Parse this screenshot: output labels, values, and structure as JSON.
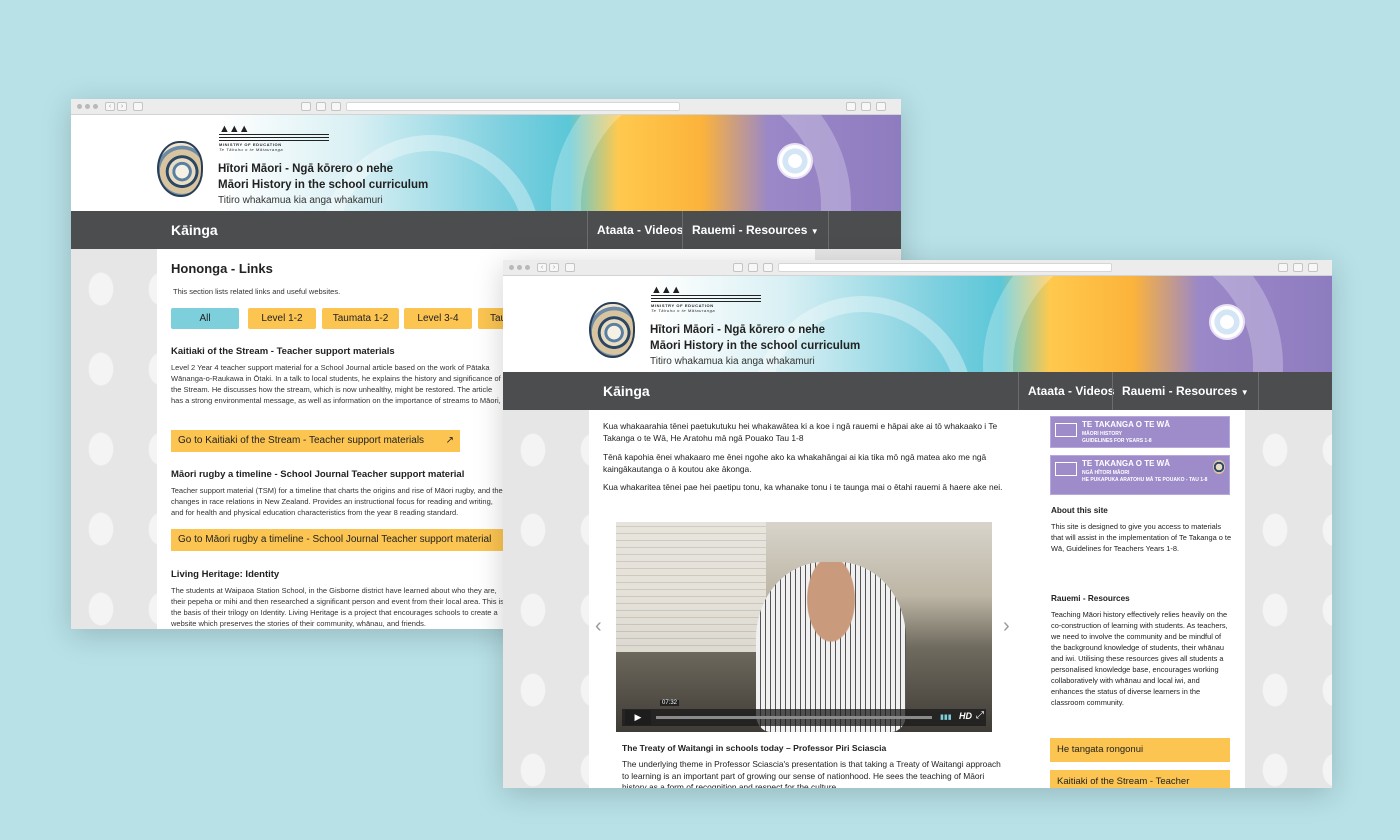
{
  "colors": {
    "background": "#b7e1e7",
    "nav": "#4b4d4f",
    "accent_yellow": "#fcc552",
    "accent_teal": "#7dcfdc",
    "accent_purple": "#9d8cc9"
  },
  "site": {
    "ministry": "MINISTRY OF EDUCATION",
    "ministry_sub": "Te Tāhuhu o te Mātauranga",
    "title_maori": "Hītori Māori - Ngā kōrero o nehe",
    "title_english": "Māori History in the school curriculum",
    "tagline": "Titiro whakamua kia anga whakamuri",
    "nav": {
      "home": "Kāinga",
      "videos": "Ataata - Videos",
      "resources": "Rauemi - Resources"
    }
  },
  "back_page": {
    "heading": "Hononga - Links",
    "intro": "This section lists related links and useful websites.",
    "filters": [
      "All",
      "Level 1-2",
      "Taumata 1-2",
      "Level 3-4",
      "Tau"
    ],
    "links": [
      {
        "title": "Kaitiaki of the Stream - Teacher support materials",
        "body": "Level 2 Year 4 teacher support material for a School Journal article based on the work of Pātaka Wānanga-o-Raukawa in Ōtaki. In a talk to local students, he explains the history and significance of the Stream. He discusses how the stream, which is now unhealthy, might be restored. The article has a strong environmental message, as well as information on the importance of streams to Māori, with particular reference to tuna (eels).",
        "button": "Go to Kaitiaki of the Stream - Teacher support materials"
      },
      {
        "title": "Māori rugby a timeline - School Journal Teacher support material",
        "body": "Teacher support material (TSM) for a timeline that charts the origins and rise of Māori rugby, and the changes in race relations in New Zealand. Provides an instructional focus for reading and writing, and for health and physical education characteristics from the year 8 reading standard.",
        "button": "Go to Māori rugby a timeline - School Journal Teacher support material"
      },
      {
        "title": "Living Heritage: Identity",
        "body": "The students at Waipaoa Station School, in the Gisborne district have learned about who they are, their pepeha or mihi and then researched a significant person and event from their local area. This is the basis of their trilogy on Identity. Living Heritage is a project that encourages schools to create a website which preserves the stories of their community, whānau, and friends.",
        "button": ""
      }
    ]
  },
  "front_page": {
    "intro": [
      "Kua whakaarahia tēnei paetukutuku hei whakawātea ki a koe i ngā rauemi e hāpai ake ai tō whakaako i Te Takanga o te Wā, He Aratohu mā ngā Pouako Tau 1-8",
      "Tēnā kapohia ēnei whakaaro me ēnei ngohe ako ka whakahāngai ai kia tika mō ngā matea ako me ngā kaingākautanga o ā koutou ake ākonga.",
      "Kua whakaritea tēnei pae hei paetipu tonu, ka whanake tonu i te taunga mai o ētahi rauemi ā haere ake nei."
    ],
    "video": {
      "time": "07:32",
      "hd": "HD",
      "caption": "The Treaty of Waitangi in schools today – Professor Piri Sciascia"
    },
    "video_text": "The underlying theme in Professor Sciascia's presentation is that taking a Treaty of Waitangi approach to learning is an important part of growing our sense of nationhood. He sees the teaching of Māori history as a form of recognition and respect for the culture.",
    "sidebar": {
      "cards": [
        {
          "title": "TE TAKANGA O TE WĀ",
          "sub1": "MĀORI HISTORY",
          "sub2": "GUIDELINES FOR YEARS 1-8"
        },
        {
          "title": "TE TAKANGA O TE WĀ",
          "sub1": "NGĀ HĪTORI MĀORI",
          "sub2": "HE PUKAPUKA ARATOHU MĀ TE POUAKO - TAU 1-8"
        }
      ],
      "about_heading": "About this site",
      "about_text": "This site is designed to give you access to materials that will assist in the implementation of Te Takanga o te Wā, Guidelines for Teachers Years 1-8.",
      "resources_heading": "Rauemi - Resources",
      "resources_text": "Teaching Māori history effectively relies heavily on the co-construction of learning with students. As teachers, we need to involve the community and be mindful of the background knowledge of students, their whānau and iwi. Utilising these resources gives all students a personalised knowledge base, encourages working collaboratively with whānau and local iwi, and enhances the status of diverse learners in the classroom community.",
      "buttons": [
        "He tangata rongonui",
        "Kaitiaki of the Stream - Teacher"
      ]
    }
  }
}
